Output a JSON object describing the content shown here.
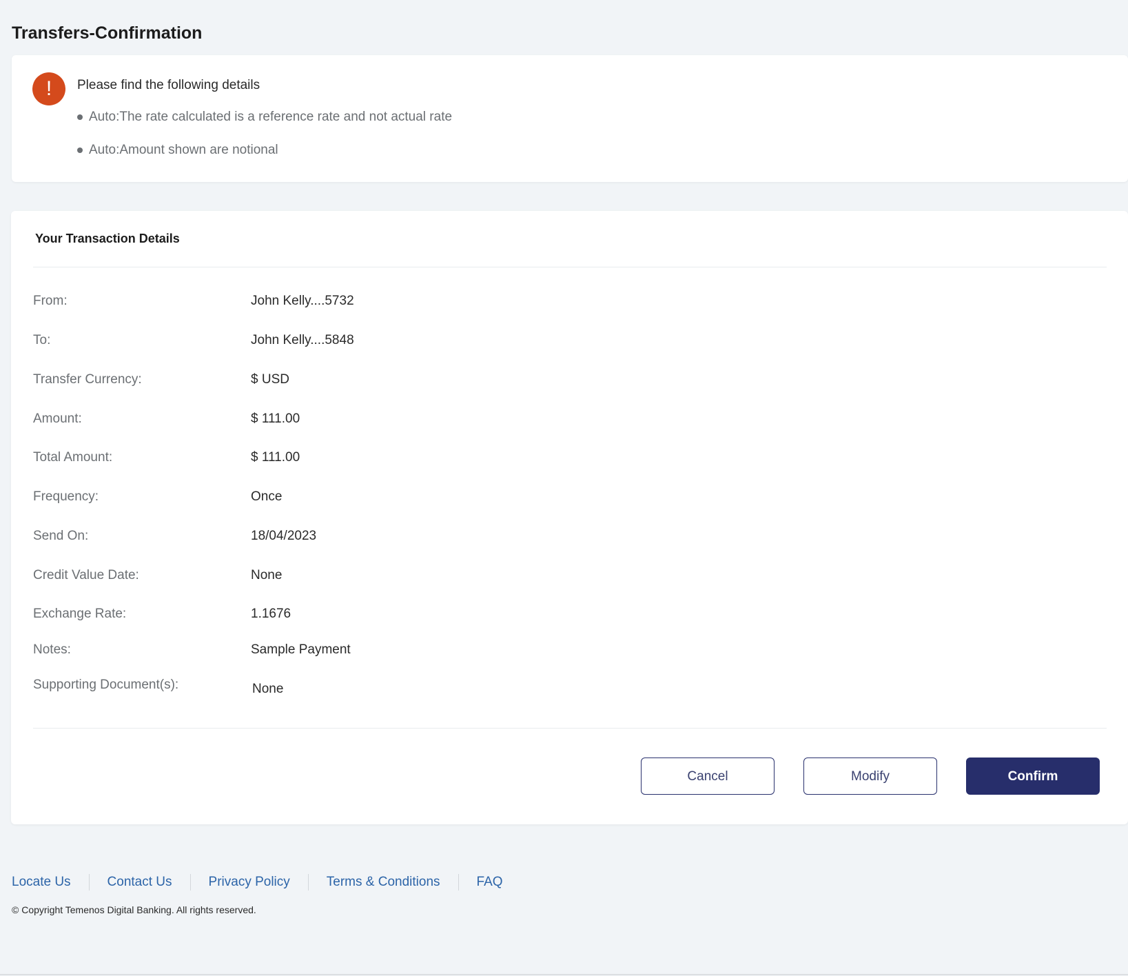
{
  "page": {
    "title": "Transfers-Confirmation"
  },
  "info": {
    "icon": "exclamation-icon",
    "icon_glyph": "!",
    "heading": "Please find the following details",
    "items": [
      "Auto:The rate calculated is a reference rate and not actual rate",
      "Auto:Amount shown are notional"
    ]
  },
  "details": {
    "title": "Your Transaction Details",
    "rows": [
      {
        "label": "From:",
        "value": "John Kelly....5732"
      },
      {
        "label": "To:",
        "value": "John Kelly....5848"
      },
      {
        "label": "Transfer Currency:",
        "value": "$ USD"
      },
      {
        "label": "Amount:",
        "value": "$ 111.00"
      },
      {
        "label": "Total Amount:",
        "value": "$ 111.00"
      },
      {
        "label": "Frequency:",
        "value": "Once"
      },
      {
        "label": "Send On:",
        "value": "18/04/2023"
      },
      {
        "label": "Credit Value Date:",
        "value": "None"
      },
      {
        "label": "Exchange Rate:",
        "value": "1.1676"
      },
      {
        "label": "Notes:",
        "value": "Sample Payment"
      },
      {
        "label": "Supporting Document(s):",
        "value": "None"
      }
    ]
  },
  "actions": {
    "cancel_label": "Cancel",
    "modify_label": "Modify",
    "confirm_label": "Confirm"
  },
  "footer": {
    "links": [
      "Locate Us",
      "Contact Us",
      "Privacy Policy",
      "Terms & Conditions",
      "FAQ"
    ],
    "copyright": "© Copyright Temenos Digital Banking. All rights reserved."
  },
  "colors": {
    "accent": "#272e6b",
    "alert": "#d44a1c",
    "link": "#2c64a8",
    "background": "#f1f4f7"
  }
}
